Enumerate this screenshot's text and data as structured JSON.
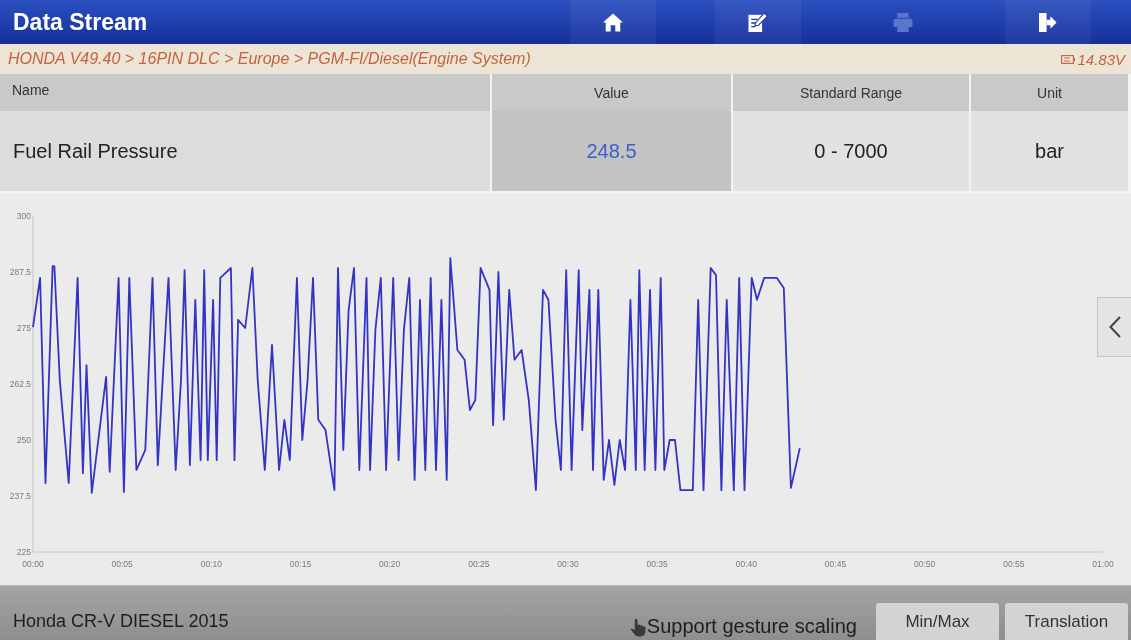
{
  "header": {
    "title": "Data Stream",
    "toolbar": [
      {
        "kind": "home",
        "disabled": false
      },
      {
        "kind": "report",
        "disabled": false
      },
      {
        "kind": "print",
        "disabled": true
      },
      {
        "kind": "exit",
        "disabled": false
      }
    ]
  },
  "breadcrumb": {
    "path": "HONDA V49.40 > 16PIN DLC > Europe > PGM-FI/Diesel(Engine System)",
    "voltage": "14.83V"
  },
  "table": {
    "columns": [
      "Name",
      "Value",
      "Standard Range",
      "Unit"
    ],
    "rows": [
      {
        "cells": [
          "Fuel Rail Pressure",
          "248.5",
          "0 - 7000",
          "bar"
        ]
      }
    ]
  },
  "chart": {
    "chart_data": {
      "type": "line",
      "x": [
        0.0,
        0.4,
        0.7,
        1.1,
        1.2,
        1.5,
        2.0,
        2.5,
        2.8,
        3.0,
        3.3,
        4.1,
        4.3,
        4.8,
        5.1,
        5.4,
        5.8,
        6.3,
        6.7,
        7.0,
        7.6,
        8.0,
        8.3,
        8.5,
        8.8,
        9.1,
        9.4,
        9.6,
        9.8,
        10.1,
        10.3,
        10.5,
        11.1,
        11.3,
        11.5,
        11.9,
        12.3,
        12.6,
        13.0,
        13.4,
        13.8,
        14.1,
        14.4,
        14.8,
        15.1,
        15.4,
        15.7,
        16.0,
        16.4,
        16.9,
        17.1,
        17.4,
        17.7,
        18.0,
        18.3,
        18.7,
        18.9,
        19.2,
        19.5,
        19.8,
        20.2,
        20.5,
        20.8,
        21.1,
        21.4,
        21.7,
        22.0,
        22.3,
        22.6,
        22.9,
        23.2,
        23.4,
        23.8,
        24.2,
        24.5,
        24.8,
        25.1,
        25.6,
        25.8,
        26.1,
        26.4,
        26.7,
        27.0,
        27.4,
        27.8,
        28.2,
        28.6,
        28.9,
        29.3,
        29.6,
        29.9,
        30.2,
        30.6,
        30.8,
        31.2,
        31.4,
        31.7,
        32.0,
        32.3,
        32.6,
        32.9,
        33.2,
        33.5,
        33.8,
        34.0,
        34.3,
        34.6,
        34.9,
        35.2,
        35.4,
        35.7,
        36.0,
        36.3,
        37.0,
        37.3,
        37.6,
        38.0,
        38.3,
        38.6,
        38.9,
        39.3,
        39.6,
        39.9,
        40.3,
        40.6,
        41.0,
        41.3,
        41.7,
        42.1,
        42.5,
        43.0
      ],
      "series": [
        {
          "color": "#3434c4",
          "values": [
            275.2,
            286.2,
            240.4,
            288.8,
            288.8,
            263.4,
            240.4,
            286.2,
            242.6,
            266.7,
            238.2,
            264.1,
            242.9,
            286.2,
            238.4,
            286.2,
            243.3,
            247.8,
            286.2,
            244.4,
            286.2,
            243.3,
            263.4,
            287.9,
            244.4,
            281.3,
            245.5,
            287.9,
            245.5,
            281.3,
            245.5,
            286.2,
            288.4,
            245.5,
            276.8,
            275.0,
            288.4,
            263.4,
            243.3,
            271.2,
            243.3,
            254.5,
            245.5,
            286.2,
            250.0,
            263.4,
            286.2,
            254.5,
            252.2,
            238.8,
            288.4,
            247.8,
            279.0,
            288.4,
            243.3,
            286.2,
            243.3,
            274.6,
            286.2,
            243.3,
            286.2,
            245.5,
            274.6,
            286.2,
            241.1,
            281.3,
            243.3,
            286.2,
            243.3,
            281.3,
            241.1,
            290.6,
            270.1,
            267.9,
            256.7,
            258.9,
            288.4,
            283.5,
            253.3,
            287.5,
            254.5,
            283.5,
            267.9,
            270.1,
            258.9,
            238.8,
            283.5,
            281.3,
            254.5,
            243.3,
            287.9,
            243.3,
            287.9,
            252.2,
            283.5,
            243.3,
            283.5,
            241.1,
            250.0,
            240.0,
            250.0,
            243.3,
            281.3,
            243.3,
            287.9,
            243.3,
            283.5,
            243.3,
            286.2,
            243.3,
            250.0,
            250.0,
            238.8,
            238.8,
            281.3,
            238.8,
            288.4,
            286.8,
            238.8,
            281.3,
            238.8,
            286.2,
            238.8,
            286.2,
            281.3,
            286.2,
            286.2,
            286.2,
            283.9,
            239.3,
            248.2
          ]
        }
      ],
      "xlim": [
        0,
        60
      ],
      "ylim": [
        225,
        300
      ],
      "xticks": [
        {
          "value": 0,
          "label": "00:00"
        },
        {
          "value": 5,
          "label": "00:05"
        },
        {
          "value": 10,
          "label": "00:10"
        },
        {
          "value": 15,
          "label": "00:15"
        },
        {
          "value": 20,
          "label": "00:20"
        },
        {
          "value": 25,
          "label": "00:25"
        },
        {
          "value": 30,
          "label": "00:30"
        },
        {
          "value": 35,
          "label": "00:35"
        },
        {
          "value": 40,
          "label": "00:40"
        },
        {
          "value": 45,
          "label": "00:45"
        },
        {
          "value": 50,
          "label": "00:50"
        },
        {
          "value": 55,
          "label": "00:55"
        },
        {
          "value": 60,
          "label": "01:00"
        }
      ],
      "yticks": [
        225,
        237.5,
        250,
        262.5,
        275,
        287.5,
        300
      ]
    }
  },
  "footer": {
    "vehicle": "Honda CR-V DIESEL 2015",
    "hint": "Support gesture scaling",
    "buttons": [
      "Min/Max",
      "Translation"
    ]
  }
}
